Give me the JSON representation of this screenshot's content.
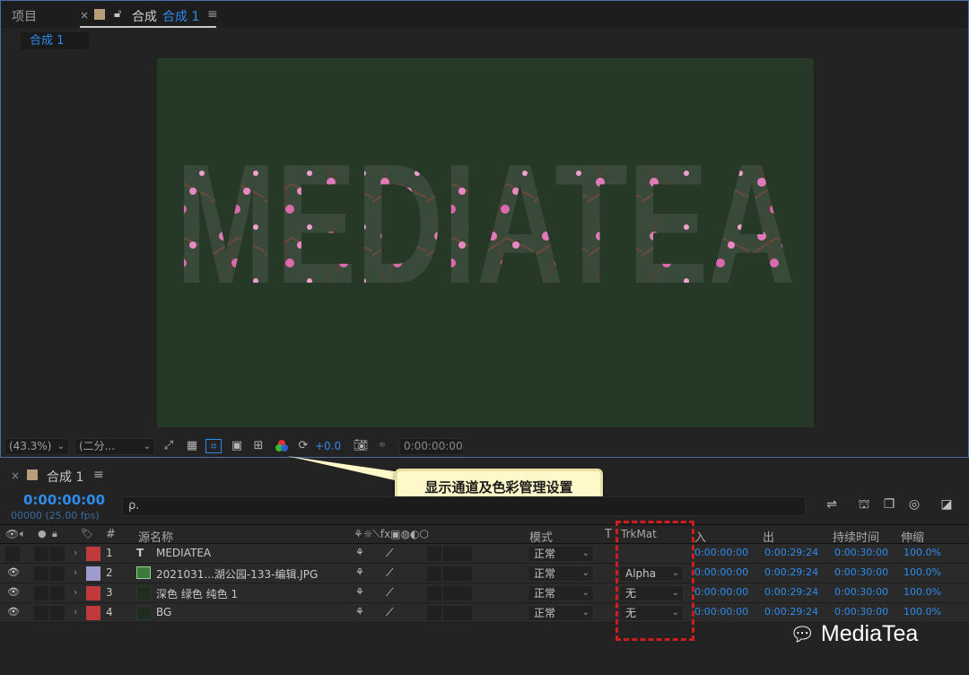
{
  "tabs": {
    "project": "项目",
    "comp_prefix": "合成",
    "comp_name": "合成 1",
    "close": "×",
    "menu": "≡"
  },
  "subtab": "合成 1",
  "canvas": {
    "text": "MEDIATEA",
    "bg_color": "#263826"
  },
  "viewer_toolbar": {
    "zoom": "(43.3%)",
    "resolution": "(二分...",
    "exposure": "+0.0",
    "timecode": "0:00:00:00"
  },
  "callout": "显示通道及色彩管理设置",
  "timeline": {
    "title": "合成 1",
    "menu": "≡",
    "current_time": "0:00:00:00",
    "frame_info": "00000 (25.00 fps)",
    "search_placeholder": "ρ."
  },
  "columns": {
    "num": "#",
    "source": "源名称",
    "mode": "模式",
    "t": "T",
    "trkmat": "TrkMat",
    "in": "入",
    "out": "出",
    "duration": "持续时间",
    "stretch": "伸缩"
  },
  "layers": [
    {
      "num": "1",
      "type": "T",
      "name": "MEDIATEA",
      "color": "#c0393b",
      "mode": "正常",
      "trkmat": "",
      "in": "0:00:00:00",
      "out": "0:00:29:24",
      "duration": "0:00:30:00",
      "stretch": "100.0%",
      "visible": false
    },
    {
      "num": "2",
      "type": "img",
      "name": "2021031...湖公园-133-编辑.JPG",
      "color": "#9d9ccc",
      "mode": "正常",
      "trkmat": "Alpha",
      "in": "0:00:00:00",
      "out": "0:00:29:24",
      "duration": "0:00:30:00",
      "stretch": "100.0%",
      "visible": true
    },
    {
      "num": "3",
      "type": "solid",
      "name": "深色 绿色 纯色 1",
      "color": "#c0393b",
      "mode": "正常",
      "trkmat": "无",
      "in": "0:00:00:00",
      "out": "0:00:29:24",
      "duration": "0:00:30:00",
      "stretch": "100.0%",
      "visible": true
    },
    {
      "num": "4",
      "type": "solid",
      "name": "BG",
      "color": "#c0393b",
      "mode": "正常",
      "trkmat": "无",
      "in": "0:00:00:00",
      "out": "0:00:29:24",
      "duration": "0:00:30:00",
      "stretch": "100.0%",
      "visible": true
    }
  ],
  "watermark": "MediaTea"
}
